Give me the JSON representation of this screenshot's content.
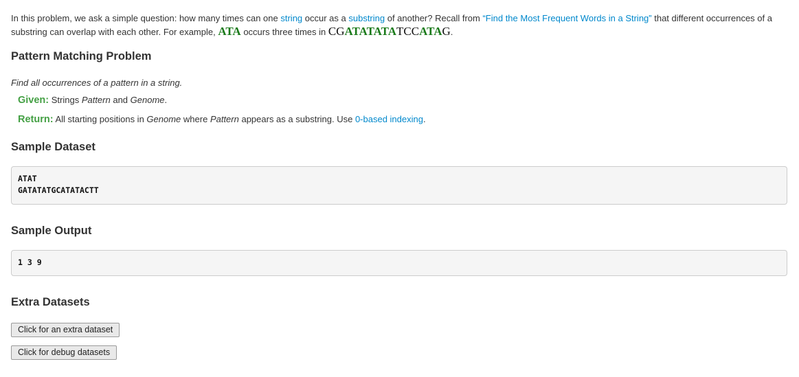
{
  "intro": {
    "t1": "In this problem, we ask a simple question: how many times can one ",
    "link_string": "string",
    "t2": " occur as a ",
    "link_substring": "substring",
    "t3": " of another? Recall from ",
    "link_freq": "“Find the Most Frequent Words in a String”",
    "t4": " that different occurrences of a substring can overlap with each other. For example, ",
    "pattern": "ATA",
    "t5": " occurs three times in ",
    "genome_parts": [
      "CG",
      "ATATATA",
      "TCC",
      "ATA",
      "G"
    ],
    "t6": "."
  },
  "problem": {
    "title": "Pattern Matching Problem",
    "definition": "Find all occurrences of a pattern in a string.",
    "given_label": "Given:",
    "given_t1": " Strings ",
    "given_pattern": "Pattern",
    "given_t2": " and ",
    "given_genome": "Genome",
    "given_t3": ".",
    "return_label": "Return:",
    "return_t1": " All starting positions in ",
    "return_genome": "Genome",
    "return_t2": " where ",
    "return_pattern": "Pattern",
    "return_t3": " appears as a substring. Use ",
    "return_link": "0-based indexing",
    "return_t4": "."
  },
  "sample_dataset": {
    "title": "Sample Dataset",
    "content": "ATAT\nGATATATGCATATACTT"
  },
  "sample_output": {
    "title": "Sample Output",
    "content": "1 3 9"
  },
  "extra": {
    "title": "Extra Datasets",
    "extra_button": "Click for an extra dataset",
    "debug_button": "Click for debug datasets"
  },
  "colors": {
    "link": "#0088cc",
    "keyword_green": "#44a044",
    "dna_green": "#1a7a1a",
    "code_bg": "#f5f5f5"
  }
}
